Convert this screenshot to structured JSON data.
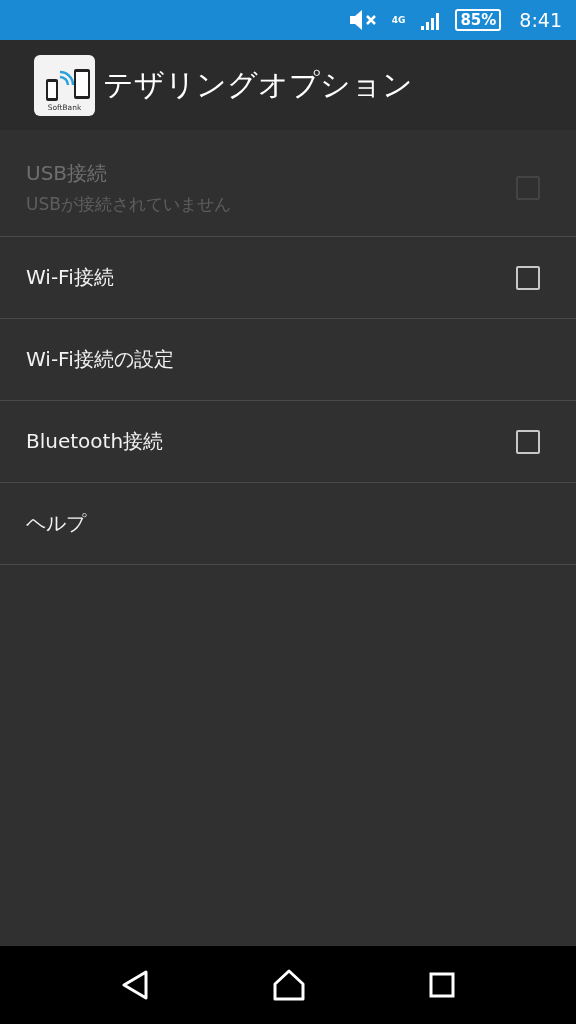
{
  "status_bar": {
    "battery": "85%",
    "network": "4G",
    "time": "8:41"
  },
  "app_bar": {
    "icon_label": "SoftBank",
    "title": "テザリングオプション"
  },
  "items": [
    {
      "kind": "checkbox",
      "title": "USB接続",
      "summary": "USBが接続されていません",
      "disabled": true,
      "checked": false
    },
    {
      "kind": "checkbox",
      "title": "Wi-Fi接続",
      "disabled": false,
      "checked": false
    },
    {
      "kind": "plain",
      "title": "Wi-Fi接続の設定",
      "disabled": false
    },
    {
      "kind": "checkbox",
      "title": "Bluetooth接続",
      "disabled": false,
      "checked": false
    },
    {
      "kind": "plain",
      "title": "ヘルプ",
      "disabled": false
    }
  ]
}
